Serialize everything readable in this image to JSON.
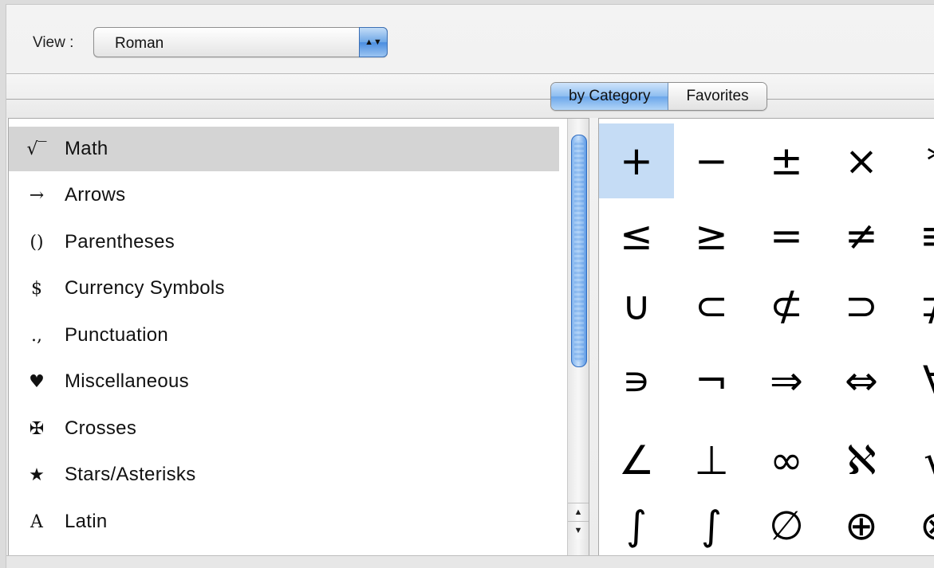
{
  "toolbar": {
    "view_label": "View :",
    "view_value": "Roman"
  },
  "segmented": {
    "tabs": [
      {
        "label": "by Category",
        "active": true
      },
      {
        "label": "Favorites",
        "active": false
      }
    ]
  },
  "categories": [
    {
      "icon": "√‾",
      "icon_name": "square-root-icon",
      "label": "Math",
      "selected": true
    },
    {
      "icon": "→",
      "icon_name": "right-arrow-icon",
      "label": "Arrows"
    },
    {
      "icon": "()",
      "icon_name": "parentheses-icon",
      "label": "Parentheses"
    },
    {
      "icon": "$",
      "icon_name": "dollar-icon",
      "label": "Currency Symbols"
    },
    {
      "icon": ".,",
      "icon_name": "punctuation-icon",
      "label": "Punctuation"
    },
    {
      "icon": "♥",
      "icon_name": "heart-icon",
      "label": "Miscellaneous"
    },
    {
      "icon": "✠",
      "icon_name": "maltese-cross-icon",
      "label": "Crosses"
    },
    {
      "icon": "★",
      "icon_name": "star-icon",
      "label": "Stars/Asterisks"
    },
    {
      "icon": "A",
      "icon_name": "latin-a-icon",
      "label": "Latin"
    }
  ],
  "glyphs": [
    [
      "+",
      "−",
      "±",
      "×",
      "*"
    ],
    [
      "≤",
      "≥",
      "=",
      "≠",
      "≡"
    ],
    [
      "∪",
      "⊂",
      "⊄",
      "⊃",
      "⊅"
    ],
    [
      "∍",
      "¬",
      "⇒",
      "⇔",
      "∀"
    ],
    [
      "∠",
      "⊥",
      "∞",
      "ℵ",
      "√"
    ],
    [
      "∫",
      "∫",
      "∅",
      "⊕",
      "⊗"
    ]
  ],
  "colors": {
    "selection_blue": "#c5dcf5",
    "list_selection": "#d4d4d4",
    "accent": "#4a8de0"
  }
}
